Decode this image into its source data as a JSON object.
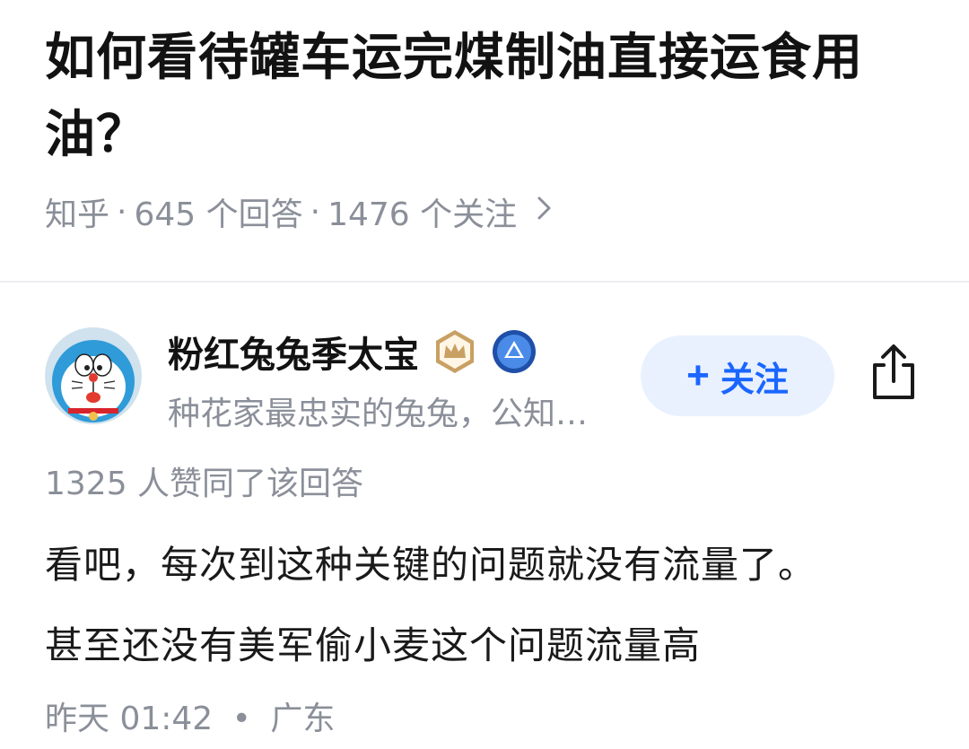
{
  "question": {
    "title": "如何看待罐车运完煤制油直接运食用油？",
    "source": "知乎",
    "answers": "645 个回答",
    "followers": "1476 个关注",
    "separator": "·"
  },
  "author": {
    "name": "粉红兔兔季太宝",
    "bio": "种花家最忠实的兔兔，公知…",
    "follow_label": "关注",
    "badges": [
      "crown-badge-icon",
      "upgrade-badge-icon"
    ]
  },
  "answer": {
    "upvotes": "1325 人赞同了该回答",
    "paragraphs": [
      "看吧，每次到这种关键的问题就没有流量了。",
      "甚至还没有美军偷小麦这个问题流量高"
    ],
    "time": "昨天 01:42",
    "location": "广东",
    "footer_separator": "•"
  },
  "colors": {
    "accent": "#1a66ff",
    "follow_bg": "#e9f1ff",
    "meta_text": "#8a8f99",
    "crown_badge": "#c9a063",
    "level_badge": "#3b6fd8"
  }
}
